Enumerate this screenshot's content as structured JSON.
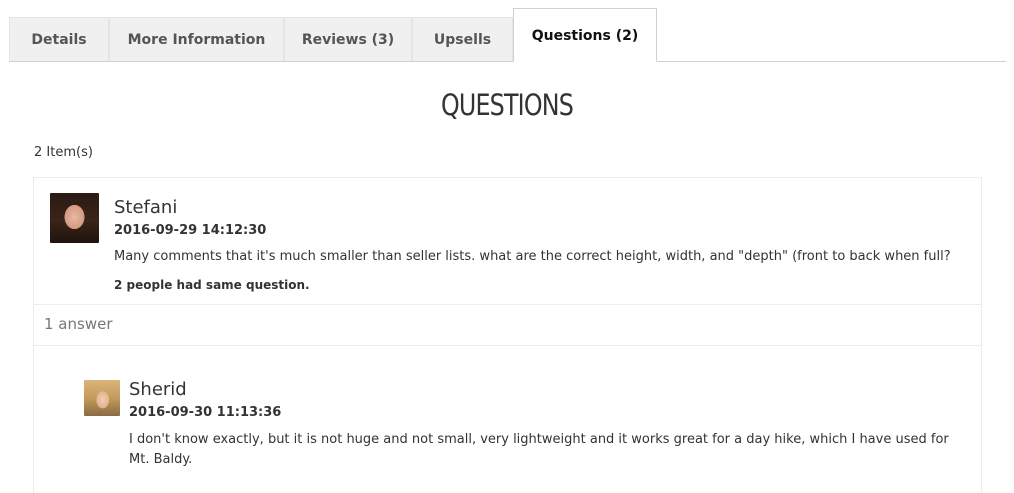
{
  "tabs": [
    {
      "label": "Details"
    },
    {
      "label": "More Information"
    },
    {
      "label": "Reviews (3)"
    },
    {
      "label": "Upsells"
    },
    {
      "label": "Questions (2)"
    }
  ],
  "section_title": "Questions",
  "items_count": "2 Item(s)",
  "question": {
    "author": "Stefani",
    "date": "2016-09-29 14:12:30",
    "text": "Many comments that it's much smaller than seller lists. what are the correct height, width, and \"depth\" (front to back when full?",
    "same_question": "2 people had same question.",
    "answer_count": "1 answer"
  },
  "answer": {
    "author": "Sherid",
    "date": "2016-09-30 11:13:36",
    "text_line1": "I don't know exactly, but it is not huge and not small, very lightweight and it works great for a day hike, which I have used for",
    "text_line2": "Mt. Baldy."
  }
}
